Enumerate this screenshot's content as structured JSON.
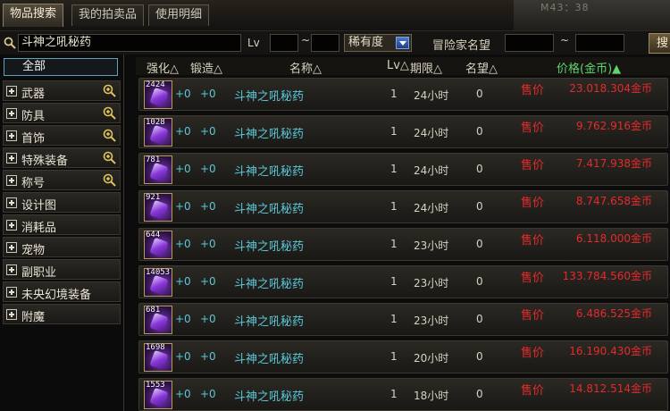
{
  "tabs": [
    "物品搜索",
    "我的拍卖品",
    "使用明细"
  ],
  "corner_text": "M43：38",
  "search": {
    "item_value": "斗神之吼秘药",
    "lv_label": "Lv",
    "range_sep": "~",
    "rarity": "稀有度",
    "seller_label": "冒险家名望",
    "button": "搜"
  },
  "sidebar": {
    "all": "全部",
    "categories": [
      {
        "label": "武器",
        "zoom": true
      },
      {
        "label": "防具",
        "zoom": true
      },
      {
        "label": "首饰",
        "zoom": true
      },
      {
        "label": "特殊装备",
        "zoom": true
      },
      {
        "label": "称号",
        "zoom": true
      },
      {
        "label": "设计图",
        "zoom": false
      },
      {
        "label": "消耗品",
        "zoom": false
      },
      {
        "label": "宠物",
        "zoom": false
      },
      {
        "label": "副职业",
        "zoom": false
      },
      {
        "label": "未央幻境装备",
        "zoom": false
      },
      {
        "label": "附魔",
        "zoom": false
      }
    ]
  },
  "columns": {
    "enhance": "强化△",
    "forge": "锻造△",
    "name": "名称△",
    "lv": "Lv△",
    "duration": "期限△",
    "reputation": "名望△",
    "price": "价格(金币)▲"
  },
  "rows": [
    {
      "qty": "2424",
      "enhance": "+0",
      "forge": "+0",
      "name": "斗神之吼秘药",
      "lv": "1",
      "duration": "24小时",
      "reputation": "0",
      "sell_label": "售价",
      "price": "23.018.304金币"
    },
    {
      "qty": "1028",
      "enhance": "+0",
      "forge": "+0",
      "name": "斗神之吼秘药",
      "lv": "1",
      "duration": "24小时",
      "reputation": "0",
      "sell_label": "售价",
      "price": "9.762.916金币"
    },
    {
      "qty": "781",
      "enhance": "+0",
      "forge": "+0",
      "name": "斗神之吼秘药",
      "lv": "1",
      "duration": "24小时",
      "reputation": "0",
      "sell_label": "售价",
      "price": "7.417.938金币"
    },
    {
      "qty": "921",
      "enhance": "+0",
      "forge": "+0",
      "name": "斗神之吼秘药",
      "lv": "1",
      "duration": "24小时",
      "reputation": "0",
      "sell_label": "售价",
      "price": "8.747.658金币"
    },
    {
      "qty": "644",
      "enhance": "+0",
      "forge": "+0",
      "name": "斗神之吼秘药",
      "lv": "1",
      "duration": "23小时",
      "reputation": "0",
      "sell_label": "售价",
      "price": "6.118.000金币"
    },
    {
      "qty": "14053",
      "enhance": "+0",
      "forge": "+0",
      "name": "斗神之吼秘药",
      "lv": "1",
      "duration": "23小时",
      "reputation": "0",
      "sell_label": "售价",
      "price": "133.784.560金币"
    },
    {
      "qty": "681",
      "enhance": "+0",
      "forge": "+0",
      "name": "斗神之吼秘药",
      "lv": "1",
      "duration": "23小时",
      "reputation": "0",
      "sell_label": "售价",
      "price": "6.486.525金币"
    },
    {
      "qty": "1698",
      "enhance": "+0",
      "forge": "+0",
      "name": "斗神之吼秘药",
      "lv": "1",
      "duration": "20小时",
      "reputation": "0",
      "sell_label": "售价",
      "price": "16.190.430金币"
    },
    {
      "qty": "1553",
      "enhance": "+0",
      "forge": "+0",
      "name": "斗神之吼秘药",
      "lv": "1",
      "duration": "18小时",
      "reputation": "0",
      "sell_label": "售价",
      "price": "14.812.514金币"
    }
  ]
}
